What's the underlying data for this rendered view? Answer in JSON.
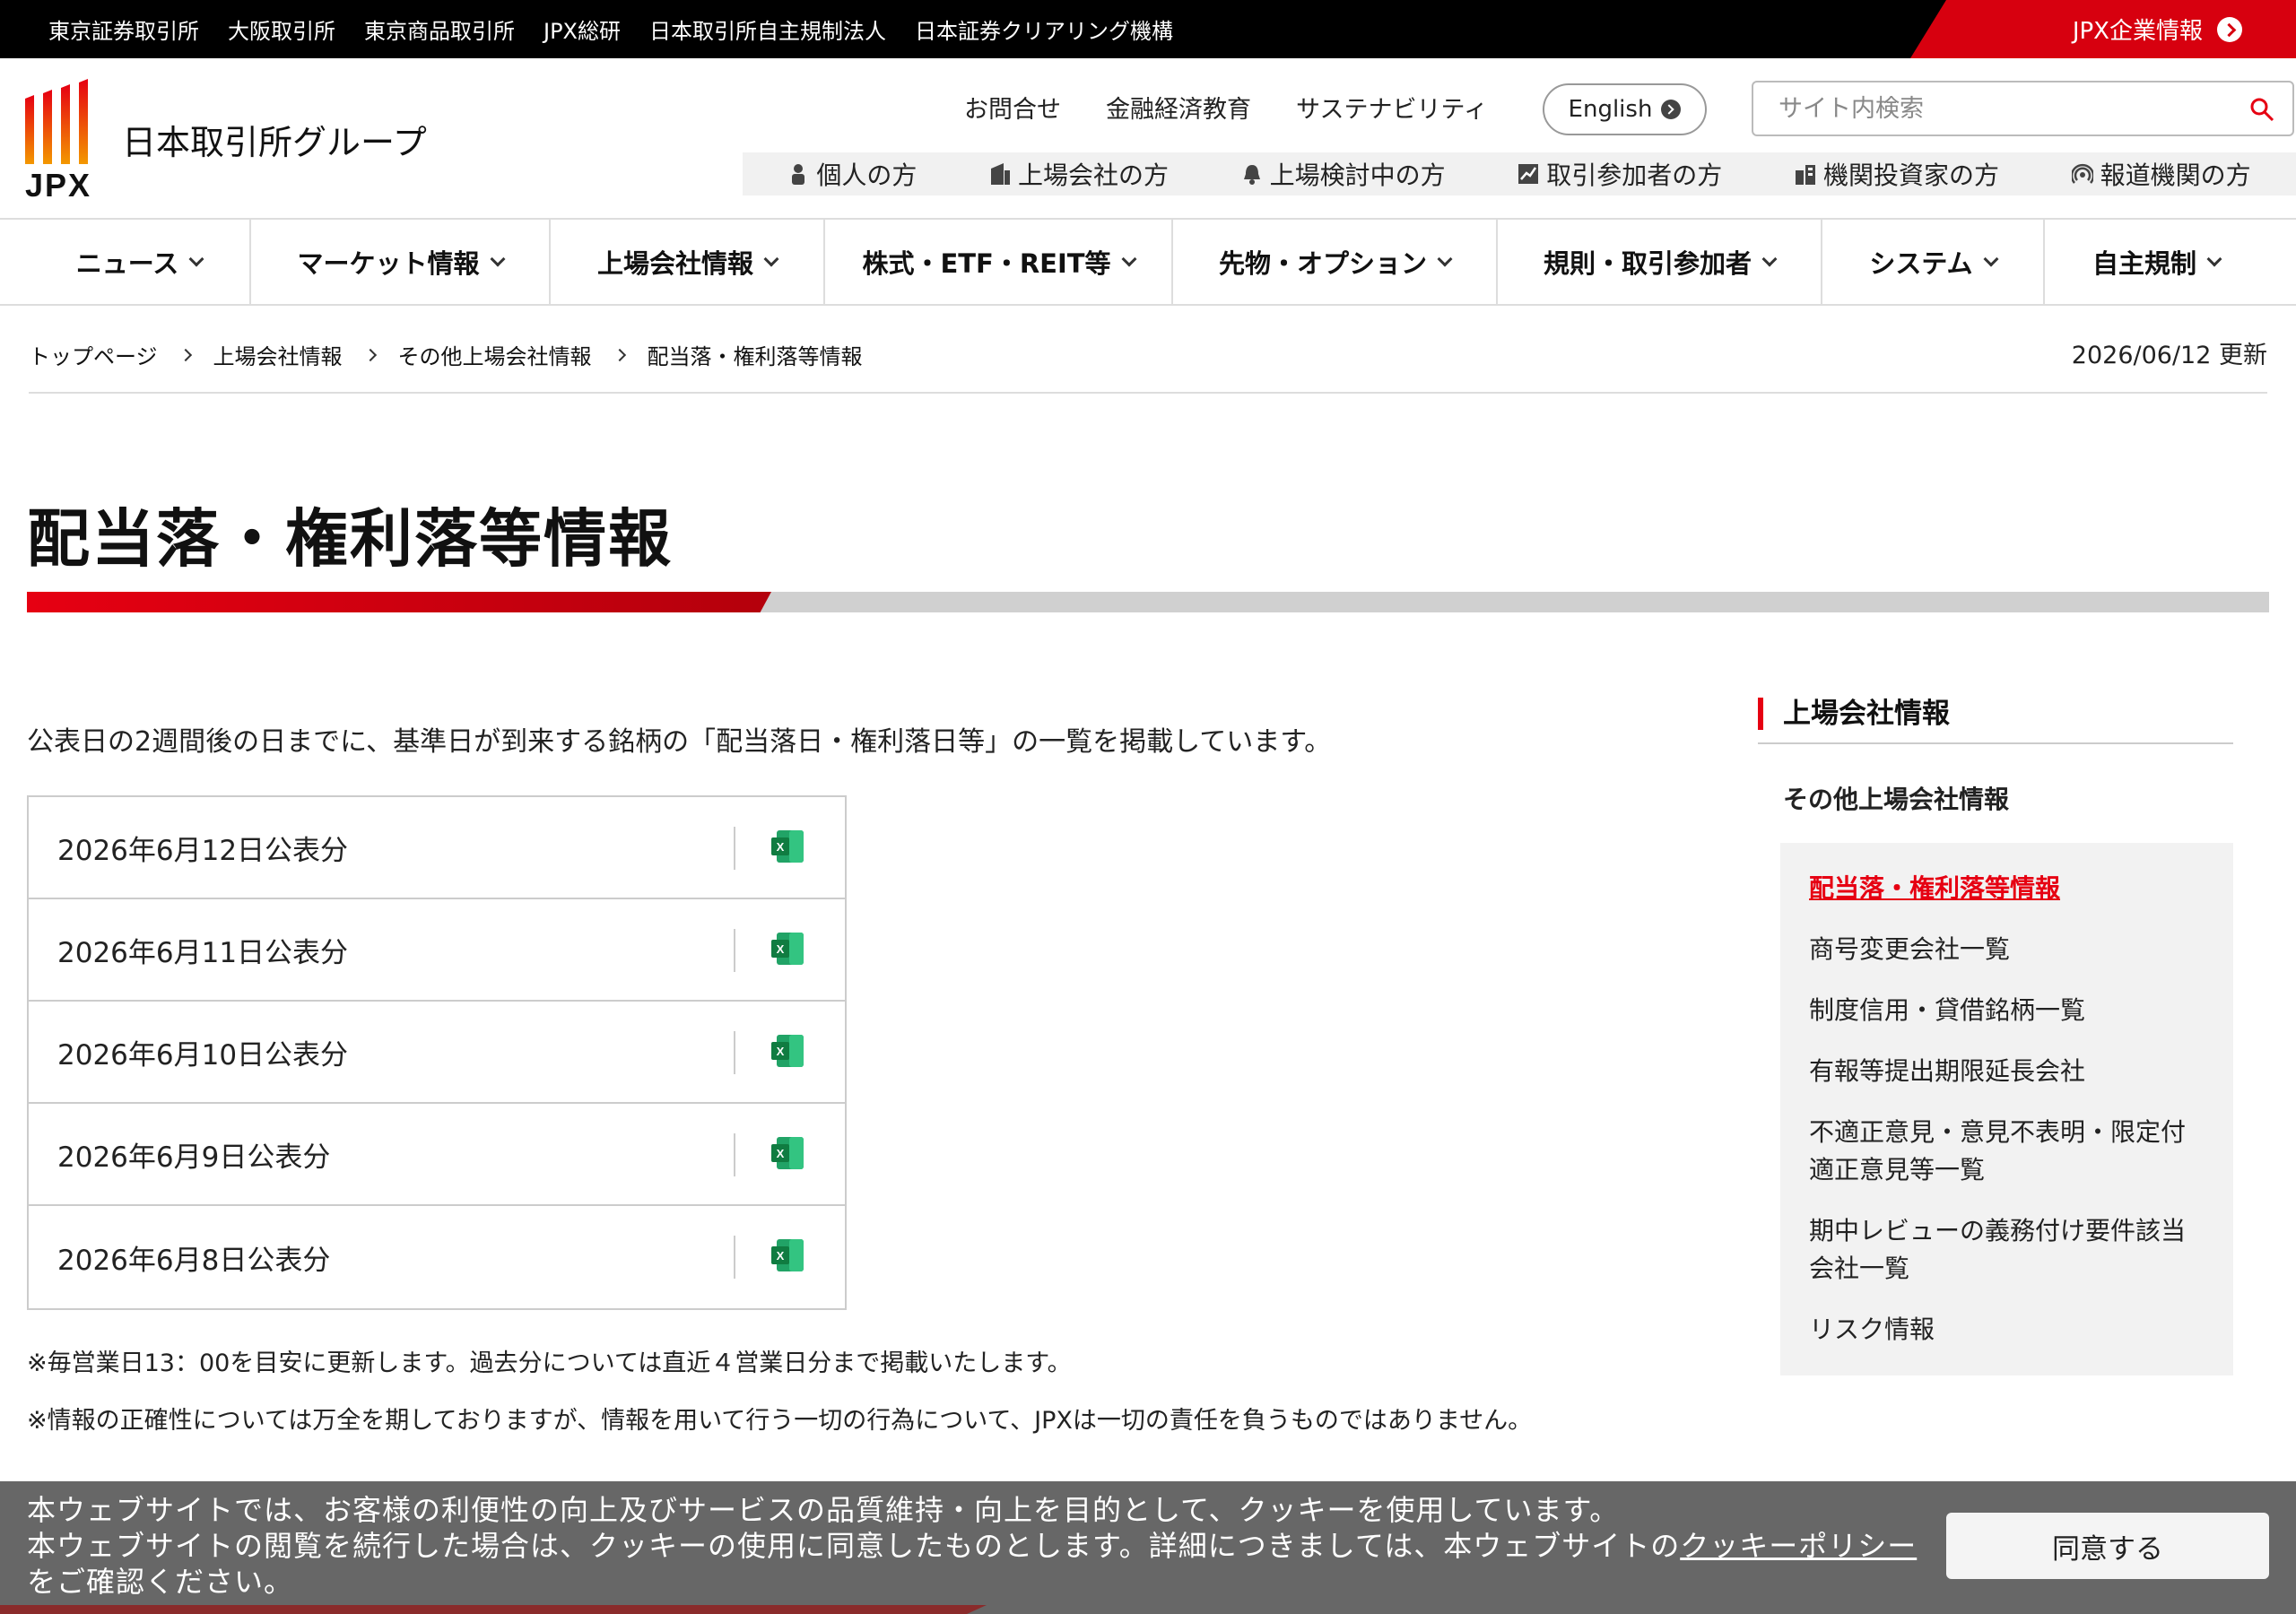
{
  "topbar": {
    "links": [
      "東京証券取引所",
      "大阪取引所",
      "東京商品取引所",
      "JPX総研",
      "日本取引所自主規制法人",
      "日本証券クリアリング機構"
    ],
    "corp_link": "JPX企業情報"
  },
  "header": {
    "logo_text": "JPX",
    "org_name": "日本取引所グループ",
    "util_links": [
      "お問合せ",
      "金融経済教育",
      "サステナビリティ"
    ],
    "english_label": "English",
    "search_placeholder": "サイト内検索",
    "audience": [
      {
        "label": "個人の方",
        "icon": "person-icon"
      },
      {
        "label": "上場会社の方",
        "icon": "building-icon"
      },
      {
        "label": "上場検討中の方",
        "icon": "bell-icon"
      },
      {
        "label": "取引参加者の方",
        "icon": "chart-icon"
      },
      {
        "label": "機関投資家の方",
        "icon": "office-icon"
      },
      {
        "label": "報道機関の方",
        "icon": "broadcast-icon"
      }
    ]
  },
  "gnav": [
    "ニュース",
    "マーケット情報",
    "上場会社情報",
    "株式・ETF・REIT等",
    "先物・オプション",
    "規則・取引参加者",
    "システム",
    "自主規制"
  ],
  "breadcrumb": [
    "トップページ",
    "上場会社情報",
    "その他上場会社情報",
    "配当落・権利落等情報"
  ],
  "updated": "2026/06/12 更新",
  "page_title": "配当落・権利落等情報",
  "lead": "公表日の2週間後の日までに、基準日が到来する銘柄の「配当落日・権利落日等」の一覧を掲載しています。",
  "files": [
    {
      "label": "2026年6月12日公表分",
      "icon": "excel-icon"
    },
    {
      "label": "2026年6月11日公表分",
      "icon": "excel-icon"
    },
    {
      "label": "2026年6月10日公表分",
      "icon": "excel-icon"
    },
    {
      "label": "2026年6月9日公表分",
      "icon": "excel-icon"
    },
    {
      "label": "2026年6月8日公表分",
      "icon": "excel-icon"
    }
  ],
  "notes": [
    "※毎営業日13：00を目安に更新します。過去分については直近４営業日分まで掲載いたします。",
    "※情報の正確性については万全を期しておりますが、情報を用いて行う一切の行為について、JPXは一切の責任を負うものではありません。"
  ],
  "sidebar": {
    "heading": "上場会社情報",
    "subheading": "その他上場会社情報",
    "items": [
      "配当落・権利落等情報",
      "商号変更会社一覧",
      "制度信用・貸借銘柄一覧",
      "有報等提出期限延長会社",
      "不適正意見・意見不表明・限定付適正意見等一覧",
      "期中レビューの義務付け要件該当会社一覧",
      "リスク情報"
    ],
    "current_index": 0
  },
  "cookie": {
    "line1": "本ウェブサイトでは、お客様の利便性の向上及びサービスの品質維持・向上を目的として、クッキーを使用しています。",
    "line2_pre": "本ウェブサイトの閲覧を続行した場合は、クッキーの使用に同意したものとします。詳細につきましては、本ウェブサイトの",
    "link": "クッキーポリシー",
    "line2_post": "をご確認ください。",
    "agree_label": "同意する"
  },
  "colors": {
    "brand_red": "#e60012",
    "topbar_bg": "#000000",
    "excel_green": "#1f7a45"
  }
}
